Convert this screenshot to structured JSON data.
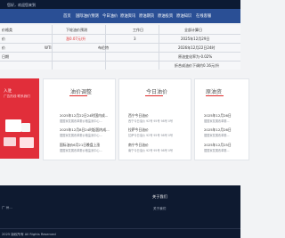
{
  "topbar": {
    "greeting": "您好，欢迎您来到"
  },
  "nav": {
    "items": [
      "首页",
      "国际油价预测",
      "今日油价",
      "原油资讯",
      "原油期货",
      "原油投资",
      "原油知识",
      "在线客服"
    ]
  },
  "info": {
    "row1": [
      "价格类",
      "下轮油价预测",
      "工作日",
      "全部计算日"
    ],
    "row1_values": [
      "",
      "涨0.07元/升",
      "3",
      "2025年12月29日"
    ],
    "row2_label_a": "WTI",
    "row2_label_b": "布伦特",
    "row2_date": "2026年12月22日24时",
    "row3_text": "原油变化率为-0.02%",
    "row4_text": "折合成油价下调约0.16元/升",
    "left_labels": [
      "价",
      "价",
      "日期"
    ]
  },
  "banner": {
    "title": "入驻",
    "subtitle": "广告热线·联系我们"
  },
  "cards": [
    {
      "title": "油价调整",
      "news": [
        {
          "headline": "2025年12月22日24时国内成...",
          "desc": "据国家发展改革委价格监测中心..."
        },
        {
          "headline": "2025年12月8日24时起国内成...",
          "desc": "据国家发展改革委价格监测中心..."
        },
        {
          "headline": "国际油价6月21日晚盘上涨",
          "desc": "据国家发展改革委价格监测中心..."
        }
      ]
    },
    {
      "title": "今日油价",
      "news": [
        {
          "headline": "西宁今日油价",
          "desc": "西宁今日油价 92号 95号 98号 0号"
        },
        {
          "headline": "拉萨今日油价",
          "desc": "拉萨今日油价 92号 95号 98号 0号"
        },
        {
          "headline": "南宁今日油价",
          "desc": "南宁今日油价 92号 95号 98号 0号"
        }
      ]
    },
    {
      "title": "原油资",
      "news": [
        {
          "headline": "2025年12月26日",
          "desc": "据国家发展改革委..."
        },
        {
          "headline": "2025年12月26日",
          "desc": "据国家发展改革委..."
        },
        {
          "headline": "2025年12月25日",
          "desc": "据国家发展改革委..."
        }
      ]
    }
  ],
  "footer": {
    "about_heading": "关于我们",
    "about_text": "关于我们",
    "left_text": "广 州...",
    "copyright": "2025 版权所有 All Rights Reserved"
  },
  "colors": {
    "nav": "#2a4f95",
    "accent": "#e02a2a",
    "footer": "#0e1a30"
  }
}
